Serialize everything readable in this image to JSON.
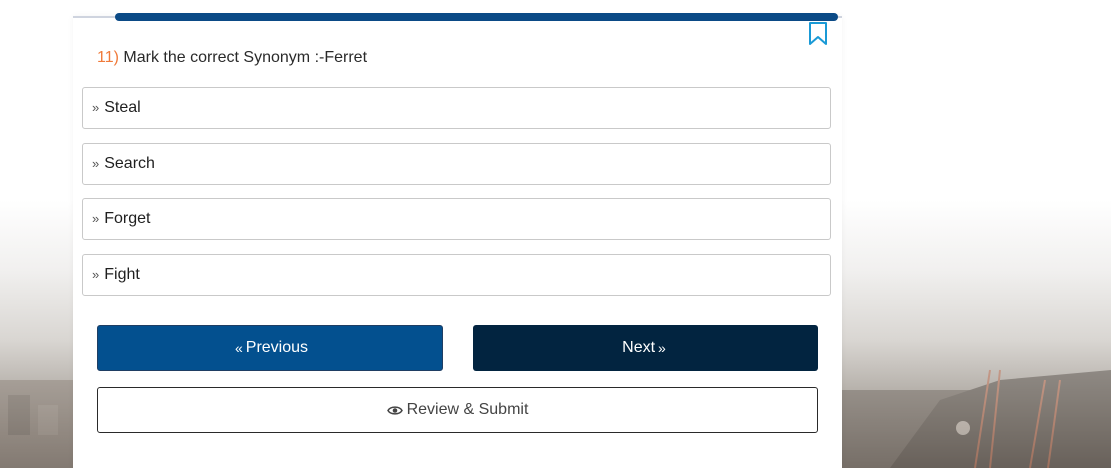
{
  "quiz": {
    "question_number": "11)",
    "question_text": "Mark the correct Synonym :-Ferret",
    "progress_fraction": 0.95,
    "options": [
      {
        "label": "Steal"
      },
      {
        "label": "Search"
      },
      {
        "label": "Forget"
      },
      {
        "label": "Fight"
      }
    ]
  },
  "buttons": {
    "previous_label": "Previous",
    "next_label": "Next",
    "review_label": "Review & Submit"
  },
  "icons": {
    "bookmark": "bookmark-icon",
    "previous": "double-chevron-left-icon",
    "next": "double-chevron-right-icon",
    "review": "eye-icon",
    "option": "double-chevron-right-icon"
  },
  "colors": {
    "accent_number": "#f07a3a",
    "progress": "#0b4a86",
    "previous_bg": "#03508f",
    "next_bg": "#022440",
    "bookmark": "#1a9ad6"
  }
}
